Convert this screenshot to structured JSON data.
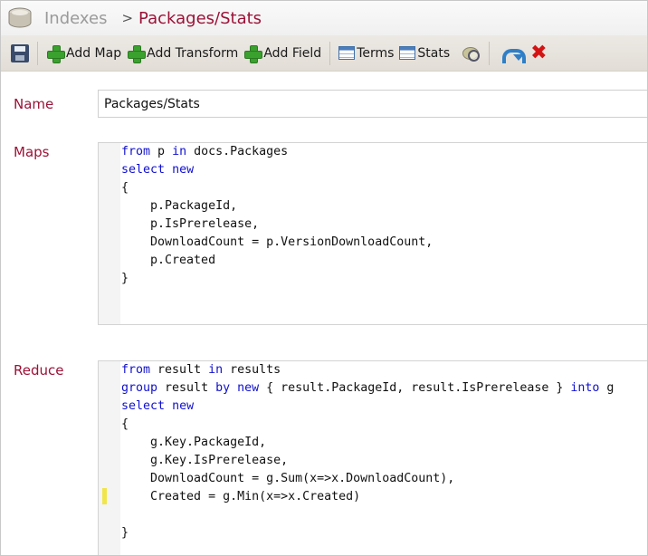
{
  "breadcrumb": {
    "root": "Indexes",
    "separator": ">",
    "current": "Packages/Stats"
  },
  "toolbar": {
    "add_map": "Add Map",
    "add_transform": "Add Transform",
    "add_field": "Add Field",
    "terms": "Terms",
    "stats": "Stats"
  },
  "form": {
    "name_label": "Name",
    "name_value": "Packages/Stats",
    "maps_label": "Maps",
    "reduce_label": "Reduce"
  },
  "maps_code": [
    [
      {
        "t": "from",
        "k": true
      },
      {
        "t": " p "
      },
      {
        "t": "in",
        "k": true
      },
      {
        "t": " docs.Packages"
      }
    ],
    [
      {
        "t": "select",
        "k": true
      },
      {
        "t": " "
      },
      {
        "t": "new",
        "k": true
      }
    ],
    [
      {
        "t": "{"
      }
    ],
    [
      {
        "t": "    p.PackageId,"
      }
    ],
    [
      {
        "t": "    p.IsPrerelease,"
      }
    ],
    [
      {
        "t": "    DownloadCount = p.VersionDownloadCount,"
      }
    ],
    [
      {
        "t": "    p.Created"
      }
    ],
    [
      {
        "t": "}"
      }
    ]
  ],
  "reduce_code": [
    [
      {
        "t": "from",
        "k": true
      },
      {
        "t": " result "
      },
      {
        "t": "in",
        "k": true
      },
      {
        "t": " results"
      }
    ],
    [
      {
        "t": "group",
        "k": true
      },
      {
        "t": " result "
      },
      {
        "t": "by",
        "k": true
      },
      {
        "t": " "
      },
      {
        "t": "new",
        "k": true
      },
      {
        "t": " { result.PackageId, result.IsPrerelease } "
      },
      {
        "t": "into",
        "k": true
      },
      {
        "t": " g"
      }
    ],
    [
      {
        "t": "select",
        "k": true
      },
      {
        "t": " "
      },
      {
        "t": "new",
        "k": true
      }
    ],
    [
      {
        "t": "{"
      }
    ],
    [
      {
        "t": "    g.Key.PackageId,"
      }
    ],
    [
      {
        "t": "    g.Key.IsPrerelease,"
      }
    ],
    [
      {
        "t": "    DownloadCount = g.Sum(x=>x.DownloadCount),"
      }
    ],
    [
      {
        "t": "    Created = g.Min(x=>x.Created)"
      }
    ],
    [
      {
        "t": ""
      }
    ],
    [
      {
        "t": "}"
      }
    ]
  ],
  "colors": {
    "accent": "#9b1237",
    "keyword": "#1010d0",
    "marker": "#f2e54a"
  },
  "icons": {
    "app": "database-icon",
    "save": "save-icon",
    "add": "plus-icon",
    "terms": "table-icon",
    "stats": "table-icon",
    "query": "query-icon",
    "undo": "undo-icon",
    "delete": "x-icon"
  }
}
